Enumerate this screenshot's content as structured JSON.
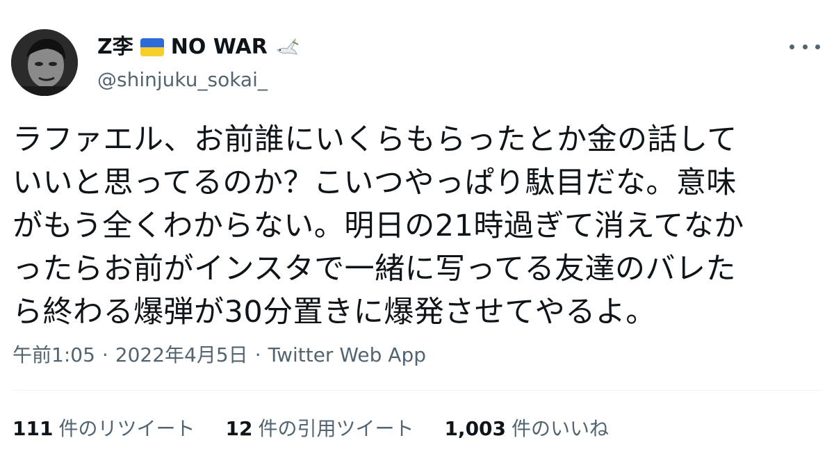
{
  "author": {
    "name": "Z李",
    "suffix": "NO WAR",
    "handle": "@shinjuku_sokai_",
    "flag_colors": [
      "#2f6ad9",
      "#f7ce2c"
    ],
    "icons": [
      "ukraine-flag-icon",
      "dove-icon"
    ]
  },
  "more_icon": "more-options-icon",
  "tweet": {
    "lines": [
      "ラファエル、お前誰にいくらもらったとか金の話して",
      "いいと思ってるのか？こいつやっぱり駄目だな。意味",
      "がもう全くわからない。明日の21時過ぎて消えてなか",
      "ったらお前がインスタで一緒に写ってる友達のバレた",
      "ら終わる爆弾が30分置きに爆発させてやるよ。"
    ]
  },
  "meta": {
    "time": "午前1:05",
    "separator": "·",
    "date": "2022年4月5日",
    "source": "Twitter Web App"
  },
  "stats": {
    "retweets": {
      "count": "111",
      "label": "件のリツイート"
    },
    "quotes": {
      "count": "12",
      "label": "件の引用ツイート"
    },
    "likes": {
      "count": "1,003",
      "label": "件のいいね"
    }
  },
  "colors": {
    "text": "#0f1419",
    "secondary": "#536471",
    "divider": "#eff3f4"
  }
}
